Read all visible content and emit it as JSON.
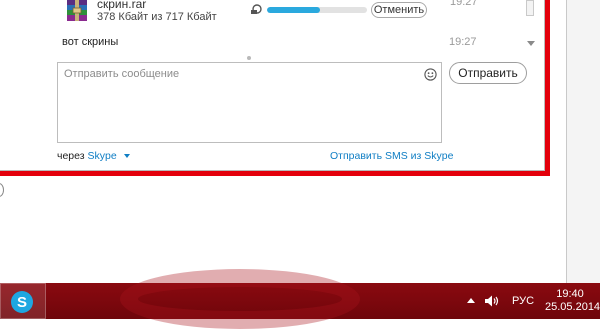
{
  "chat": {
    "file_name": "скрин.rar",
    "file_size": "378 Кбайт из 717 Кбайт",
    "transfer_progress": 0.53,
    "cancel_label": "Отменить",
    "top_time": "19:27",
    "message_text": "вот скрины",
    "message_time": "19:27",
    "compose_placeholder": "Отправить сообщение",
    "send_label": "Отправить",
    "via_prefix": "через",
    "via_service": "Skype",
    "sms_link": "Отправить SMS из Skype"
  },
  "taskbar": {
    "language": "РУС",
    "time": "19:40",
    "date": "25.05.2014"
  },
  "icons": {
    "archive": "winrar-archive-icon",
    "transfer": "file-transfer-icon",
    "emoji": "emoticon-icon",
    "skype": "skype-logo-icon",
    "speaker": "speaker-icon",
    "tray": "show-hidden-icons-arrow"
  },
  "colors": {
    "highlight_border": "#e3000b",
    "progress": "#2aa9de",
    "link": "#0f7ec4",
    "taskbar": "#7a070d"
  }
}
